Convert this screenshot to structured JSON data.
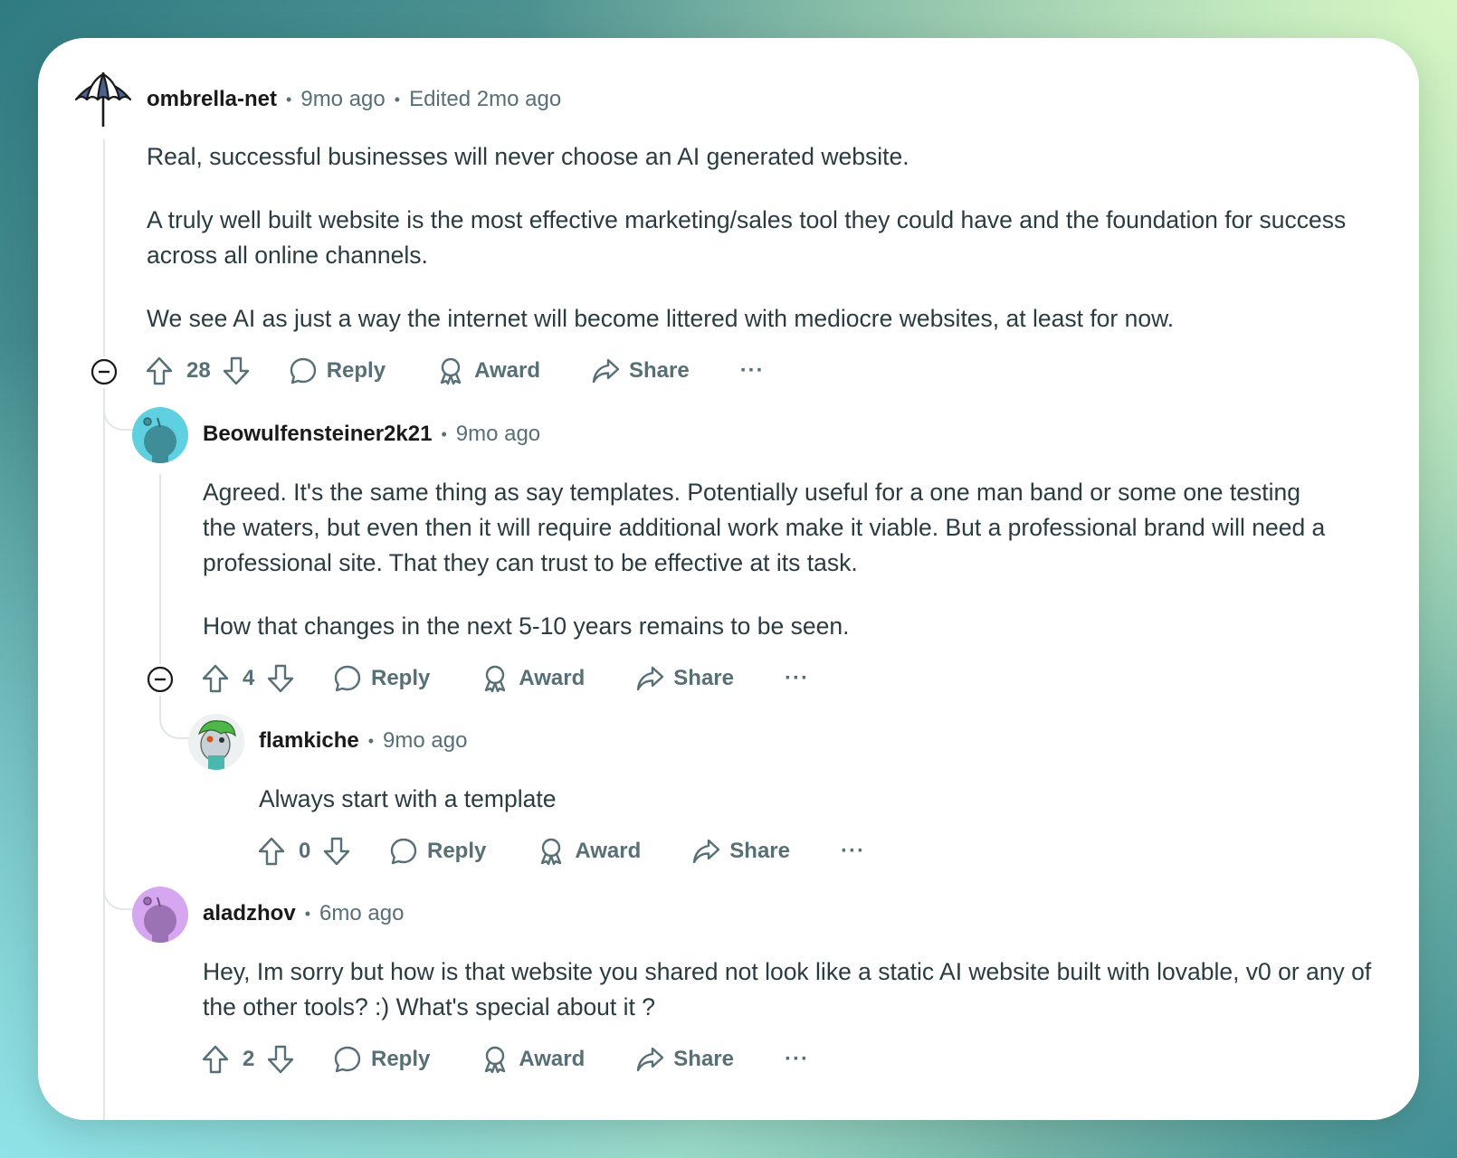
{
  "comments": [
    {
      "username": "ombrella-net",
      "time": "9mo ago",
      "edited": "Edited 2mo ago",
      "paragraphs": [
        "Real, successful businesses will never choose an AI generated website.",
        "A truly well built website is the most effective marketing/sales tool they could have and the foundation for success across all online channels.",
        "We see AI as just a way the internet will become littered with mediocre websites, at least for now."
      ],
      "score": "28",
      "avatar_icon": "umbrella-icon"
    },
    {
      "username": "Beowulfensteiner2k21",
      "time": "9mo ago",
      "paragraphs": [
        "Agreed. It's the same thing as say templates. Potentially useful for a one man band or some one testing the waters, but even then it will require additional work make it viable. But a professional brand will need a professional site. That they can trust to be effective at its task.",
        "How that changes in the next 5-10 years remains to be seen."
      ],
      "score": "4",
      "avatar_color": "#5fd0e0"
    },
    {
      "username": "flamkiche",
      "time": "9mo ago",
      "paragraphs": [
        "Always start with a template"
      ],
      "score": "0"
    },
    {
      "username": "aladzhov",
      "time": "6mo ago",
      "paragraphs": [
        "Hey, Im sorry but how is that website you shared not look like a static AI website built with lovable, v0 or any of the other tools? :) What's special about it ?"
      ],
      "score": "2",
      "avatar_color": "#d6a6f0"
    }
  ],
  "actions": {
    "reply": "Reply",
    "award": "Award",
    "share": "Share",
    "more": "···"
  },
  "separator": "•"
}
